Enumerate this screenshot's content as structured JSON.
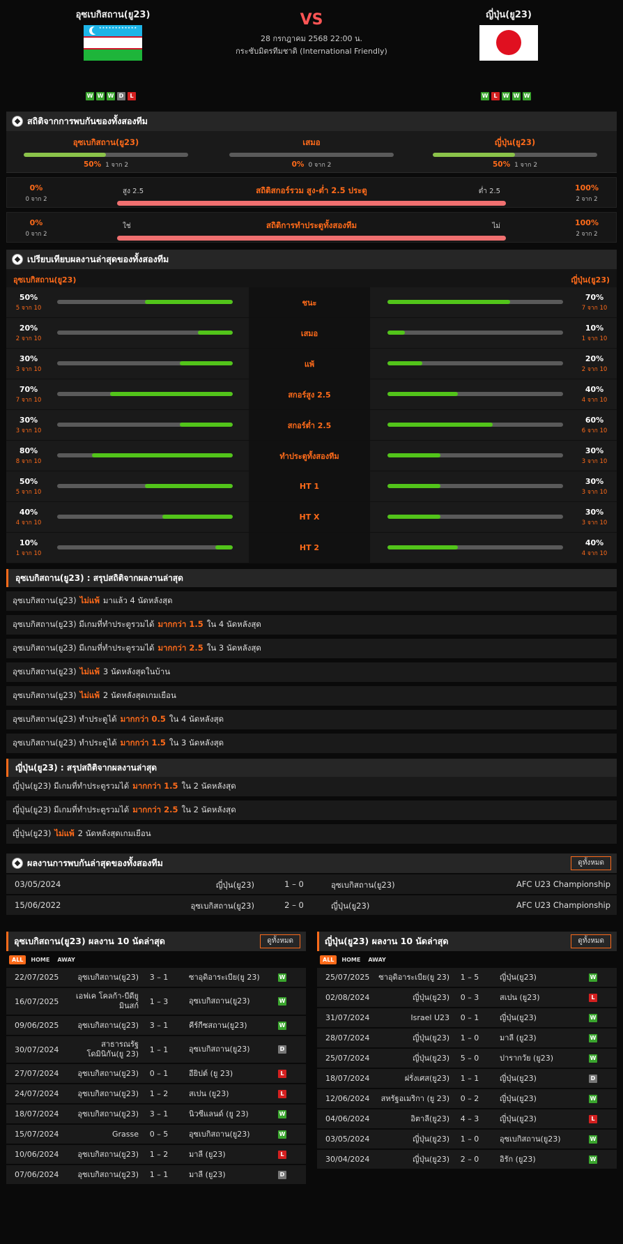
{
  "header": {
    "home": "อุซเบกิสถาน(ยู23)",
    "away": "ญี่ปุ่น(ยู23)",
    "vs": "VS",
    "date": "28 กรกฎาคม 2568 22:00 น.",
    "competition": "กระชับมิตรทีมชาติ (International Friendly)",
    "home_form": [
      "W",
      "W",
      "W",
      "D",
      "L"
    ],
    "away_form": [
      "W",
      "L",
      "W",
      "W",
      "W"
    ],
    "uz_stars": "★★★★★★★★★★★★",
    "colors": {
      "accent": "#ff6b1a",
      "win": "#3aa52e",
      "loss": "#d42020",
      "draw": "#777777"
    }
  },
  "h2h_stats": {
    "title": "สถิติจากการพบกันของทั้งสองทีม",
    "cols": [
      {
        "label": "อุซเบกิสถาน(ยู23)",
        "pct": "50%",
        "of": "1 จาก 2",
        "value": 0.5
      },
      {
        "label": "เสมอ",
        "pct": "0%",
        "of": "0 จาก 2",
        "value": 0
      },
      {
        "label": "ญี่ปุ่น(ยู23)",
        "pct": "50%",
        "of": "1 จาก 2",
        "value": 0.5
      }
    ],
    "ou": {
      "left_pct": "0%",
      "left_of": "0 จาก 2",
      "over_label": "สูง 2.5",
      "title": "สถิติสกอร์รวม สูง-ต่ำ 2.5 ประตู",
      "under_label": "ต่ำ 2.5",
      "right_pct": "100%",
      "right_of": "2 จาก 2"
    },
    "btts": {
      "left_pct": "0%",
      "left_of": "0 จาก 2",
      "yes_label": "ใช่",
      "title": "สถิติการทำประตูทั้งสองทีม",
      "no_label": "ไม่",
      "right_pct": "100%",
      "right_of": "2 จาก 2"
    }
  },
  "compare": {
    "title": "เปรียบเทียบผลงานล่าสุดของทั้งสองทีม",
    "home": "อุซเบกิสถาน(ยู23)",
    "away": "ญี่ปุ่น(ยู23)",
    "rows": [
      {
        "label": "ชนะ",
        "lp": "50%",
        "lo": "5 จาก 10",
        "lv": 0.5,
        "rp": "70%",
        "ro": "7 จาก 10",
        "rv": 0.7
      },
      {
        "label": "เสมอ",
        "lp": "20%",
        "lo": "2 จาก 10",
        "lv": 0.2,
        "rp": "10%",
        "ro": "1 จาก 10",
        "rv": 0.1
      },
      {
        "label": "แพ้",
        "lp": "30%",
        "lo": "3 จาก 10",
        "lv": 0.3,
        "rp": "20%",
        "ro": "2 จาก 10",
        "rv": 0.2
      },
      {
        "label": "สกอร์สูง 2.5",
        "lp": "70%",
        "lo": "7 จาก 10",
        "lv": 0.7,
        "rp": "40%",
        "ro": "4 จาก 10",
        "rv": 0.4
      },
      {
        "label": "สกอร์ต่ำ 2.5",
        "lp": "30%",
        "lo": "3 จาก 10",
        "lv": 0.3,
        "rp": "60%",
        "ro": "6 จาก 10",
        "rv": 0.6
      },
      {
        "label": "ทำประตูทั้งสองทีม",
        "lp": "80%",
        "lo": "8 จาก 10",
        "lv": 0.8,
        "rp": "30%",
        "ro": "3 จาก 10",
        "rv": 0.3
      },
      {
        "label": "HT 1",
        "lp": "50%",
        "lo": "5 จาก 10",
        "lv": 0.5,
        "rp": "30%",
        "ro": "3 จาก 10",
        "rv": 0.3
      },
      {
        "label": "HT X",
        "lp": "40%",
        "lo": "4 จาก 10",
        "lv": 0.4,
        "rp": "30%",
        "ro": "3 จาก 10",
        "rv": 0.3
      },
      {
        "label": "HT 2",
        "lp": "10%",
        "lo": "1 จาก 10",
        "lv": 0.1,
        "rp": "40%",
        "ro": "4 จาก 10",
        "rv": 0.4
      }
    ]
  },
  "home_summary": {
    "title": "อุซเบกิสถาน(ยู23) : สรุปสถิติจากผลงานล่าสุด",
    "rows": [
      {
        "pre": "อุซเบกิสถาน(ยู23)",
        "hl": "ไม่แพ้",
        "post": "มาแล้ว 4 นัดหลังสุด"
      },
      {
        "pre": "อุซเบกิสถาน(ยู23) มีเกมที่ทำประตูรวมได้",
        "hl": "มากกว่า 1.5",
        "post": "ใน 4 นัดหลังสุด"
      },
      {
        "pre": "อุซเบกิสถาน(ยู23) มีเกมที่ทำประตูรวมได้",
        "hl": "มากกว่า 2.5",
        "post": "ใน 3 นัดหลังสุด"
      },
      {
        "pre": "อุซเบกิสถาน(ยู23)",
        "hl": "ไม่แพ้",
        "post": "3 นัดหลังสุดในบ้าน"
      },
      {
        "pre": "อุซเบกิสถาน(ยู23)",
        "hl": "ไม่แพ้",
        "post": "2 นัดหลังสุดเกมเยือน"
      },
      {
        "pre": "อุซเบกิสถาน(ยู23) ทำประตูได้",
        "hl": "มากกว่า 0.5",
        "post": "ใน 4 นัดหลังสุด"
      },
      {
        "pre": "อุซเบกิสถาน(ยู23) ทำประตูได้",
        "hl": "มากกว่า 1.5",
        "post": "ใน 3 นัดหลังสุด"
      }
    ]
  },
  "away_summary": {
    "title": "ญี่ปุ่น(ยู23) : สรุปสถิติจากผลงานล่าสุด",
    "rows": [
      {
        "pre": "ญี่ปุ่น(ยู23) มีเกมที่ทำประตูรวมได้",
        "hl": "มากกว่า 1.5",
        "post": "ใน 2 นัดหลังสุด"
      },
      {
        "pre": "ญี่ปุ่น(ยู23) มีเกมที่ทำประตูรวมได้",
        "hl": "มากกว่า 2.5",
        "post": "ใน 2 นัดหลังสุด"
      },
      {
        "pre": "ญี่ปุ่น(ยู23)",
        "hl": "ไม่แพ้",
        "post": "2 นัดหลังสุดเกมเยือน"
      }
    ]
  },
  "h2h_results": {
    "title": "ผลงานการพบกันล่าสุดของทั้งสองทีม",
    "view_all": "ดูทั้งหมด",
    "rows": [
      {
        "date": "03/05/2024",
        "home": "ญี่ปุ่น(ยู23)",
        "score": "1 – 0",
        "away": "อุซเบกิสถาน(ยู23)",
        "comp": "AFC U23 Championship"
      },
      {
        "date": "15/06/2022",
        "home": "อุซเบกิสถาน(ยู23)",
        "score": "2 – 0",
        "away": "ญี่ปุ่น(ยู23)",
        "comp": "AFC U23 Championship"
      }
    ]
  },
  "last10_home": {
    "title": "อุซเบกิสถาน(ยู23) ผลงาน 10 นัดล่าสุด",
    "view_all": "ดูทั้งหมด",
    "filters": [
      "ALL",
      "HOME",
      "AWAY"
    ],
    "rows": [
      {
        "date": "22/07/2025",
        "home": "อุซเบกิสถาน(ยู23)",
        "score": "3 – 1",
        "away": "ซาอุดิอาระเบีย(ยู 23)",
        "res": "W",
        "tall": false
      },
      {
        "date": "16/07/2025",
        "home": "เอฟเค โคลก้า-บีดียูมินสก์",
        "score": "1 – 3",
        "away": "อุซเบกิสถาน(ยู23)",
        "res": "W",
        "tall": true
      },
      {
        "date": "09/06/2025",
        "home": "อุซเบกิสถาน(ยู23)",
        "score": "3 – 1",
        "away": "คีร์กีซสถาน(ยู23)",
        "res": "W",
        "tall": false
      },
      {
        "date": "30/07/2024",
        "home": "สาธารณรัฐโดมินิกัน(ยู 23)",
        "score": "1 – 1",
        "away": "อุซเบกิสถาน(ยู23)",
        "res": "D",
        "tall": true
      },
      {
        "date": "27/07/2024",
        "home": "อุซเบกิสถาน(ยู23)",
        "score": "0 – 1",
        "away": "อียิปต์ (ยู 23)",
        "res": "L",
        "tall": false
      },
      {
        "date": "24/07/2024",
        "home": "อุซเบกิสถาน(ยู23)",
        "score": "1 – 2",
        "away": "สเปน (ยู23)",
        "res": "L",
        "tall": false
      },
      {
        "date": "18/07/2024",
        "home": "อุซเบกิสถาน(ยู23)",
        "score": "3 – 1",
        "away": "นิวซีแลนด์ (ยู 23)",
        "res": "W",
        "tall": false
      },
      {
        "date": "15/07/2024",
        "home": "Grasse",
        "score": "0 – 5",
        "away": "อุซเบกิสถาน(ยู23)",
        "res": "W",
        "tall": false
      },
      {
        "date": "10/06/2024",
        "home": "อุซเบกิสถาน(ยู23)",
        "score": "1 – 2",
        "away": "มาลี (ยู23)",
        "res": "L",
        "tall": false
      },
      {
        "date": "07/06/2024",
        "home": "อุซเบกิสถาน(ยู23)",
        "score": "1 – 1",
        "away": "มาลี (ยู23)",
        "res": "D",
        "tall": false
      }
    ]
  },
  "last10_away": {
    "title": "ญี่ปุ่น(ยู23) ผลงาน 10 นัดล่าสุด",
    "view_all": "ดูทั้งหมด",
    "filters": [
      "ALL",
      "HOME",
      "AWAY"
    ],
    "rows": [
      {
        "date": "25/07/2025",
        "home": "ซาอุดิอาระเบีย(ยู 23)",
        "score": "1 – 5",
        "away": "ญี่ปุ่น(ยู23)",
        "res": "W",
        "tall": false
      },
      {
        "date": "02/08/2024",
        "home": "ญี่ปุ่น(ยู23)",
        "score": "0 – 3",
        "away": "สเปน (ยู23)",
        "res": "L",
        "tall": false
      },
      {
        "date": "31/07/2024",
        "home": "Israel U23",
        "score": "0 – 1",
        "away": "ญี่ปุ่น(ยู23)",
        "res": "W",
        "tall": false
      },
      {
        "date": "28/07/2024",
        "home": "ญี่ปุ่น(ยู23)",
        "score": "1 – 0",
        "away": "มาลี (ยู23)",
        "res": "W",
        "tall": false
      },
      {
        "date": "25/07/2024",
        "home": "ญี่ปุ่น(ยู23)",
        "score": "5 – 0",
        "away": "ปารากวัย (ยู23)",
        "res": "W",
        "tall": false
      },
      {
        "date": "18/07/2024",
        "home": "ฝรั่งเศส(ยู23)",
        "score": "1 – 1",
        "away": "ญี่ปุ่น(ยู23)",
        "res": "D",
        "tall": false
      },
      {
        "date": "12/06/2024",
        "home": "สหรัฐอเมริกา (ยู 23)",
        "score": "0 – 2",
        "away": "ญี่ปุ่น(ยู23)",
        "res": "W",
        "tall": false
      },
      {
        "date": "04/06/2024",
        "home": "อิตาลี(ยู23)",
        "score": "4 – 3",
        "away": "ญี่ปุ่น(ยู23)",
        "res": "L",
        "tall": false
      },
      {
        "date": "03/05/2024",
        "home": "ญี่ปุ่น(ยู23)",
        "score": "1 – 0",
        "away": "อุซเบกิสถาน(ยู23)",
        "res": "W",
        "tall": false
      },
      {
        "date": "30/04/2024",
        "home": "ญี่ปุ่น(ยู23)",
        "score": "2 – 0",
        "away": "อิรัก (ยู23)",
        "res": "W",
        "tall": false
      }
    ]
  }
}
